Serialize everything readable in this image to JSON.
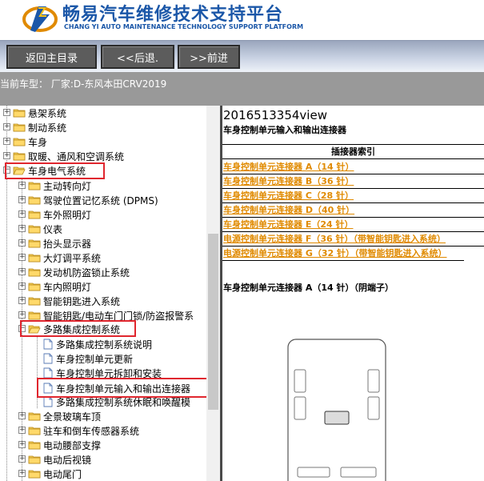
{
  "header": {
    "title_cn": "畅易汽车维修技术支持平台",
    "title_en": "CHANG YI AUTO MAINTENANCE TECHNOLOGY SUPPORT PLATFORM"
  },
  "toolbar": {
    "home_label": "返回主目录",
    "back_label": "<<后退.",
    "forward_label": ">>前进"
  },
  "status": {
    "current_vehicle": "当前车型： 厂家:D-东风本田CRV2019"
  },
  "tree": {
    "items": [
      {
        "label": "悬架系统"
      },
      {
        "label": "制动系统"
      },
      {
        "label": "车身"
      },
      {
        "label": "取暖、通风和空调系统"
      },
      {
        "label": "车身电气系统"
      },
      {
        "label": "主动转向灯"
      },
      {
        "label": "驾驶位置记忆系统 (DPMS)"
      },
      {
        "label": "车外照明灯"
      },
      {
        "label": "仪表"
      },
      {
        "label": "抬头显示器"
      },
      {
        "label": "大灯调平系统"
      },
      {
        "label": "发动机防盗锁止系统"
      },
      {
        "label": "车内照明灯"
      },
      {
        "label": "智能钥匙进入系统"
      },
      {
        "label": "智能钥匙/电动车门门锁/防盗报警系"
      },
      {
        "label": "多路集成控制系统"
      },
      {
        "label": "多路集成控制系统说明"
      },
      {
        "label": "车身控制单元更新"
      },
      {
        "label": "车身控制单元拆卸和安装"
      },
      {
        "label": "车身控制单元输入和输出连接器"
      },
      {
        "label": "多路集成控制系统休眠和唤醒模"
      },
      {
        "label": "全景玻璃车顶"
      },
      {
        "label": "驻车和倒车传感器系统"
      },
      {
        "label": "电动腰部支撑"
      },
      {
        "label": "电动后视镜"
      },
      {
        "label": "电动尾门"
      }
    ]
  },
  "content": {
    "view_title": "2016513354view",
    "subtitle": "车身控制单元输入和输出连接器",
    "index_header": "插接器索引",
    "links": [
      "车身控制单元连接器 A（14 针）",
      "车身控制单元连接器 B（36 针）",
      "车身控制单元连接器 C（28 针）",
      "车身控制单元连接器 D（40 针）",
      "车身控制单元连接器 E（24 针）",
      "电源控制单元连接器 F（36 针）（带智能钥匙进入系统）",
      "电源控制单元连接器 G（32 针）（带智能钥匙进入系统）"
    ],
    "section_heading": "车身控制单元连接器 A（14 针）（阴端子）"
  },
  "colors": {
    "brand_blue": "#1b57a8",
    "link_orange": "#e08a00",
    "highlight_red": "#e0262e",
    "status_gray": "#999999"
  }
}
